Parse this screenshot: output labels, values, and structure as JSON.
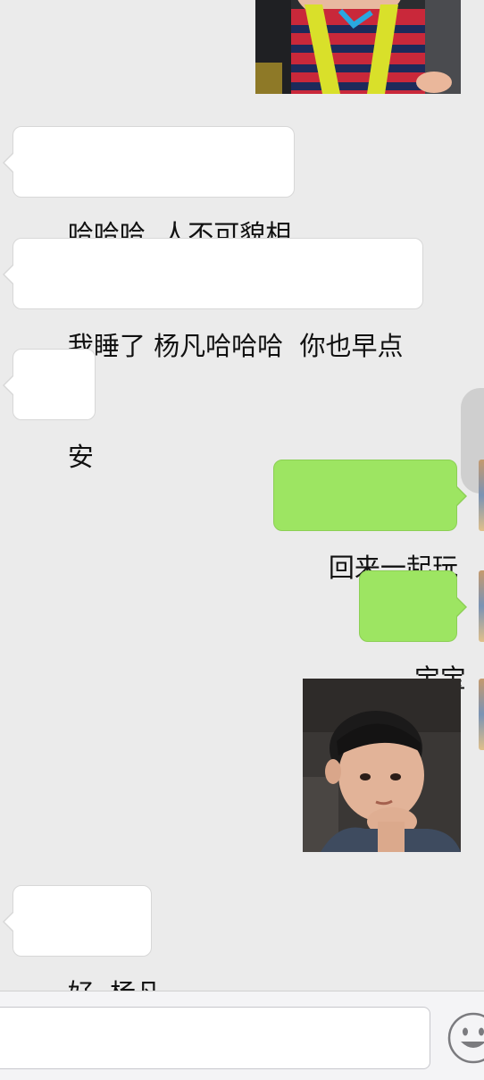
{
  "conversation": {
    "messages": [
      {
        "side": "received",
        "type": "text",
        "text": "哈哈哈  人不可貌相"
      },
      {
        "side": "received",
        "type": "text",
        "text": "我睡了 杨凡哈哈哈  你也早点"
      },
      {
        "side": "received",
        "type": "text",
        "text": "安"
      },
      {
        "side": "sent",
        "type": "text",
        "text": "回来一起玩"
      },
      {
        "side": "sent",
        "type": "text",
        "text": "宝宝"
      },
      {
        "side": "sent",
        "type": "image",
        "text": ""
      },
      {
        "side": "received",
        "type": "text",
        "text": "好  杨凡"
      }
    ]
  },
  "input_bar": {
    "value": "",
    "placeholder": "",
    "emoji_icon": "smiley-face-icon"
  },
  "colors": {
    "background": "#ebebeb",
    "received_bubble": "#ffffff",
    "sent_bubble": "#9de562",
    "input_bar": "#f4f4f6"
  }
}
